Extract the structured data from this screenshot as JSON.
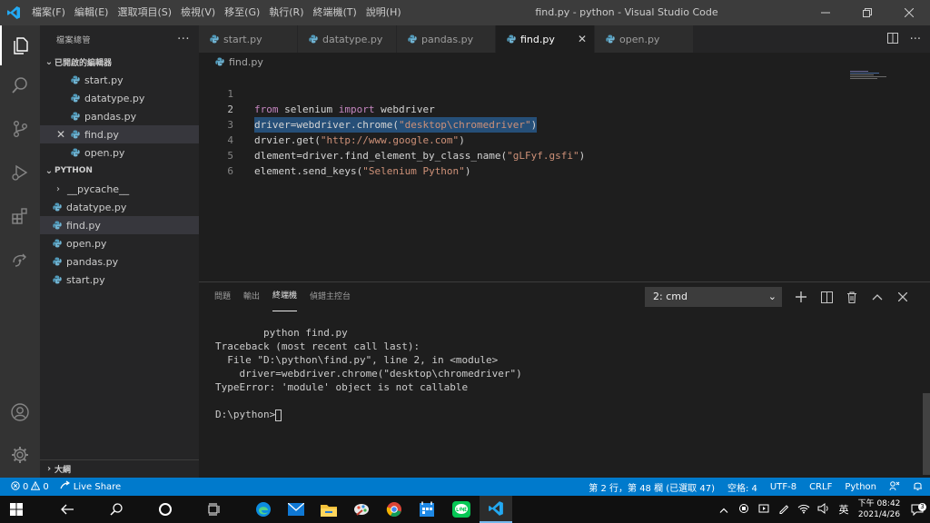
{
  "titlebar": {
    "menu": [
      "檔案(F)",
      "編輯(E)",
      "選取項目(S)",
      "檢視(V)",
      "移至(G)",
      "執行(R)",
      "終端機(T)",
      "說明(H)"
    ],
    "title": "find.py - python - Visual Studio Code"
  },
  "sidebar": {
    "header": "檔案總管",
    "open_editors_label": "已開啟的編輯器",
    "open_editors": [
      {
        "name": "start.py"
      },
      {
        "name": "datatype.py"
      },
      {
        "name": "pandas.py"
      },
      {
        "name": "find.py"
      },
      {
        "name": "open.py"
      }
    ],
    "folder_label": "PYTHON",
    "files": [
      "__pycache__",
      "datatype.py",
      "find.py",
      "open.py",
      "pandas.py",
      "start.py"
    ],
    "outline_label": "大綱"
  },
  "tabs": [
    {
      "label": "start.py"
    },
    {
      "label": "datatype.py"
    },
    {
      "label": "pandas.py"
    },
    {
      "label": "find.py"
    },
    {
      "label": "open.py"
    }
  ],
  "breadcrumb": "find.py",
  "editor": {
    "line_numbers": [
      "1",
      "2",
      "3",
      "4",
      "5",
      "6"
    ],
    "line1": {
      "kw1": "from",
      "mid": " selenium ",
      "kw2": "import",
      "rest": " webdriver"
    },
    "line2": {
      "pre": "driver=webdriver.chrome(",
      "str": "\"desktop\\chromedriver\"",
      "post": ")"
    },
    "line3": {
      "pre": "drvier.get(",
      "str": "\"http://www.google.com\"",
      "post": ")"
    },
    "line4": {
      "pre": "dlement=driver.find_element_by_class_name(",
      "str": "\"gLFyf.gsfi\"",
      "post": ")"
    },
    "line5": {
      "pre": "element.send_keys(",
      "str": "\"Selenium Python\"",
      "post": ")"
    }
  },
  "panel": {
    "tabs": [
      "問題",
      "輸出",
      "終端機",
      "偵錯主控台"
    ],
    "terminal_select": "2: cmd",
    "terminal_lines": [
      "        python find.py",
      "Traceback (most recent call last):",
      "  File \"D:\\python\\find.py\", line 2, in <module>",
      "    driver=webdriver.chrome(\"desktop\\chromedriver\")",
      "TypeError: 'module' object is not callable",
      ""
    ],
    "prompt": "D:\\python>"
  },
  "statusbar": {
    "errors": "0",
    "warnings": "0",
    "live_share": "Live Share",
    "position": "第 2 行，第 48 欄 (已選取 47)",
    "spaces": "空格: 4",
    "encoding": "UTF-8",
    "eol": "CRLF",
    "language": "Python"
  },
  "taskbar": {
    "ime": "英",
    "time": "下午 08:42",
    "date": "2021/4/26",
    "notification_count": "3"
  },
  "colors": {
    "accent": "#007acc",
    "python_icon": "#519aba",
    "string": "#ce9178",
    "keyword": "#c586c0"
  }
}
